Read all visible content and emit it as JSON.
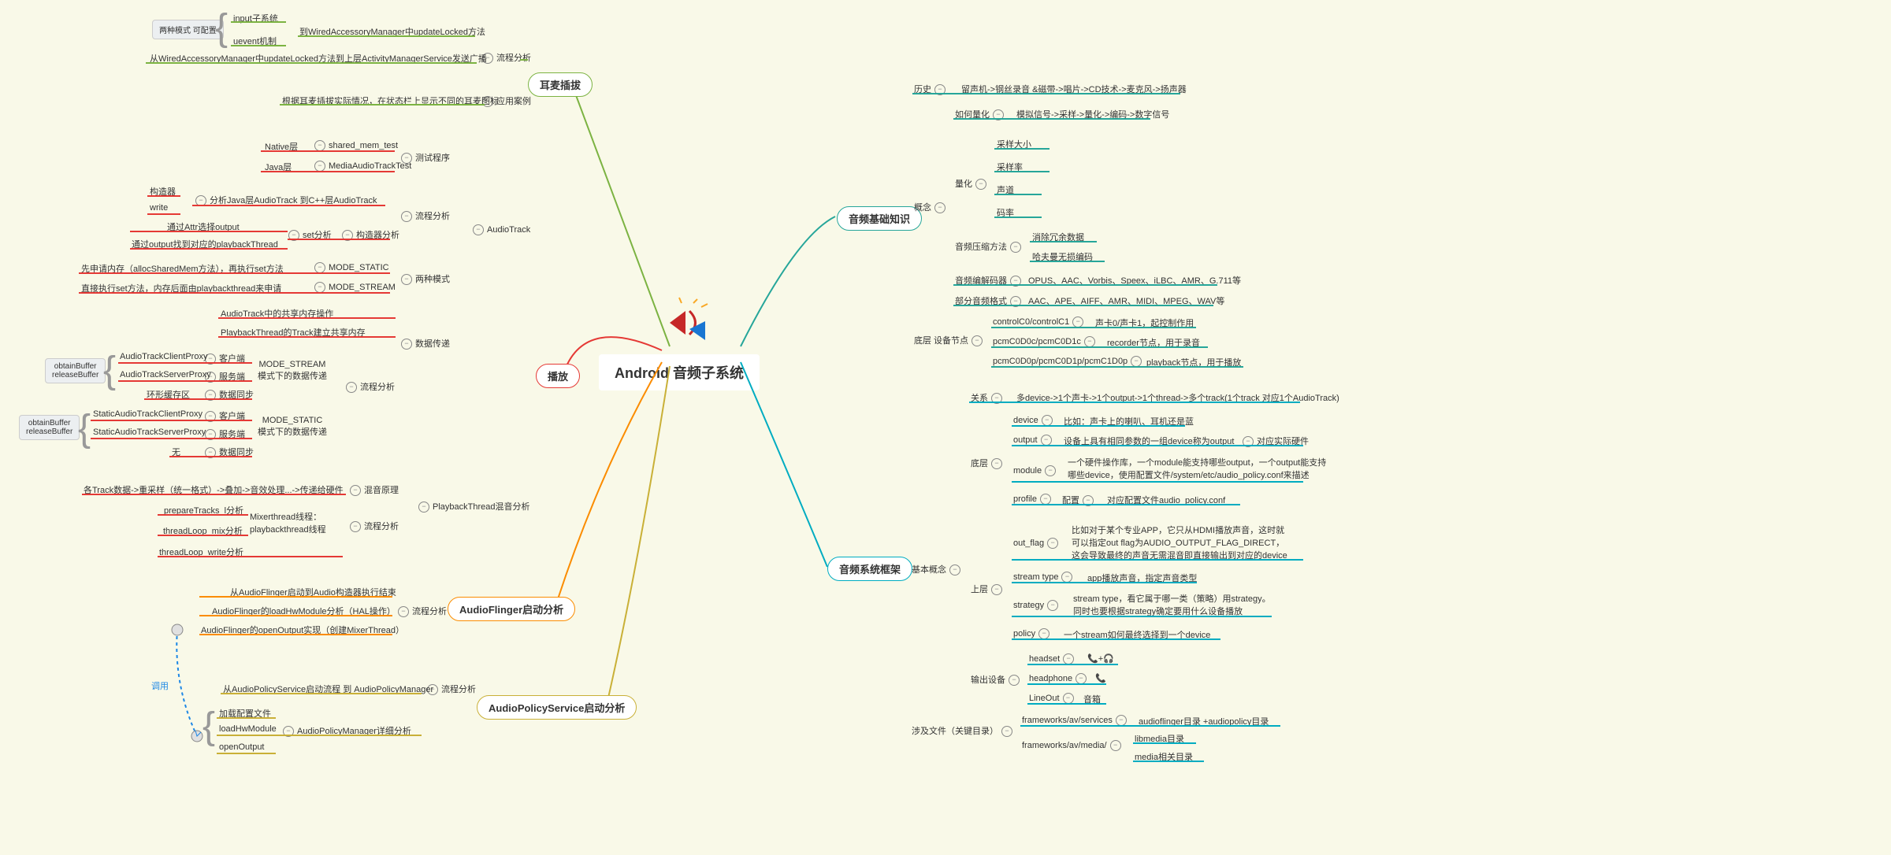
{
  "center": {
    "title": "Android 音频子系统"
  },
  "badges": {
    "mode_config": "两种模式 可配置",
    "obtain1": "obtainBuffer\nreleaseBuffer",
    "obtain2": "obtainBuffer\nreleaseBuffer",
    "invoke": "调用"
  },
  "branches": {
    "earjack": {
      "label": "耳麦插拔",
      "items": {
        "flow": "流程分析",
        "case": "应用案例",
        "input": "input子系统",
        "uevent": "uevent机制",
        "update": "到WiredAccessoryManager中updateLocked方法",
        "broadcast": "从WiredAccessoryManager中updateLocked方法到上层ActivityManagerService发送广播",
        "icon": "根据耳麦插拔实际情况，在状态栏上显示不同的耳麦图标"
      }
    },
    "playback": {
      "label": "播放",
      "nodes": {
        "audiotrack": "AudioTrack",
        "test": "测试程序",
        "native": "Native层",
        "shared_mem": "shared_mem_test",
        "java": "Java层",
        "mediatest": "MediaAudioTrackTest",
        "flow": "流程分析",
        "ctor": "构造器分析",
        "set": "set分析",
        "construct": "构造器",
        "write": "write",
        "java_cpp": "分析Java层AudioTrack 到C++层AudioTrack",
        "attr": "通过Attr选择output",
        "output_thread": "通过output找到对应的playbackThread",
        "twomode": "两种模式",
        "static": "MODE_STATIC",
        "stream": "MODE_STREAM",
        "static_desc": "先申请内存（allocSharedMem方法），再执行set方法",
        "stream_desc": "直接执行set方法，内存后面由playbackthread来申请",
        "data": "数据传递",
        "shared": "AudioTrack中的共享内存操作",
        "pbshared": "PlaybackThread的Track建立共享内存",
        "flow2": "流程分析",
        "stream_mode": "MODE_STREAM\n模式下的数据传递",
        "static_mode": "MODE_STATIC\n模式下的数据传递",
        "client": "客户端",
        "server": "服务端",
        "atcp": "AudioTrackClientProxy",
        "atsp": "AudioTrackServerProxy",
        "ring": "环形缓存区",
        "sync": "数据同步",
        "satcp": "StaticAudioTrackClientProxy",
        "satsp": "StaticAudioTrackServerProxy",
        "none": "无",
        "sync2": "数据同步",
        "pbmix": "PlaybackThread混音分析",
        "mixprinciple": "混音原理",
        "mixdesc": "各Track数据->重采样（统一格式）->叠加->音效处理...->传递给硬件",
        "flow3": "流程分析",
        "mixer": "Mixerthread线程：\nplaybackthread线程",
        "prepare": "prepareTracks_l分析",
        "tloop": "threadLoop_mix分析",
        "twrite": "threadLoop_write分析"
      }
    },
    "flinger": {
      "label": "AudioFlinger启动分析",
      "items": {
        "flow": "流程分析",
        "start": "从AudioFlinger启动到Audio构造器执行结束",
        "hal": "AudioFlinger的loadHwModule分析（HAL操作）",
        "open": "AudioFlinger的openOutput实现（创建MixerThread）"
      }
    },
    "policy": {
      "label": "AudioPolicyService启动分析",
      "items": {
        "flow": "流程分析",
        "start": "从AudioPolicyService启动流程 到 AudioPolicyManager",
        "mgr": "AudioPolicyManager详细分析",
        "load_config": "加载配置文件",
        "loadhw": "loadHwModule",
        "openout": "openOutput"
      }
    },
    "basics": {
      "label": "音频基础知识",
      "items": {
        "history": "历史",
        "history_v": "留声机->钢丝录音 &磁带->唱片->CD技术->麦克风->扬声器",
        "concept": "概念",
        "quant_how": "如何量化",
        "quant_how_v": "模拟信号->采样->量化->编码->数字信号",
        "quant": "量化",
        "sample_size": "采样大小",
        "sample_rate": "采样率",
        "channel": "声道",
        "bitrate": "码率",
        "compress": "音频压缩方法",
        "remove": "消除冗余数据",
        "huffman": "哈夫曼无损编码",
        "codec": "音频编解码器",
        "codec_v": "OPUS、AAC、Vorbis、Speex、iLBC、AMR、G.711等",
        "format": "部分音频格式",
        "format_v": "AAC、APE、AIFF、AMR、MIDI、MPEG、WAV等",
        "bottom": "底层 设备节点",
        "control": "controlC0/controlC1",
        "control_v": "声卡0/声卡1，起控制作用",
        "pcm_c": "pcmC0D0c/pcmC0D1c",
        "pcm_c_v": "recorder节点，用于录音",
        "pcm_p": "pcmC0D0p/pcmC0D1p/pcmC1D0p",
        "pcm_p_v": "playback节点，用于播放"
      }
    },
    "framework": {
      "label": "音频系统框架",
      "items": {
        "basic": "基本概念",
        "relation": "关系",
        "relation_v": "多device->1个声卡->1个output->1个thread->多个track(1个track 对应1个AudioTrack)",
        "bottom": "底层",
        "device": "device",
        "device_v": "比如：声卡上的喇叭、耳机还是蓝",
        "output": "output",
        "output_v": "设备上具有相同参数的一组device称为output",
        "output_v2": "对应实际硬件",
        "module": "module",
        "module_v": "一个硬件操作库，一个module能支持哪些output，一个output能支持\n哪些device，使用配置文件/system/etc/audio_policy.conf来描述",
        "profile": "profile",
        "profile_v1": "配置",
        "profile_v2": "对应配置文件audio_policy.conf",
        "upper": "上层",
        "outflag": "out_flag",
        "outflag_v": "比如对于某个专业APP，它只从HDMI播放声音，这时就\n可以指定out flag为AUDIO_OUTPUT_FLAG_DIRECT，\n这会导致最终的声音无需混音即直接输出到对应的device",
        "streamtype": "stream type",
        "streamtype_v": "app播放声音，指定声音类型",
        "strategy": "strategy",
        "strategy_v": "stream type，看它属于哪一类（策略）用strategy。\n同时也要根据strategy确定要用什么设备播放",
        "policy": "policy",
        "policy_v": "一个stream如何最终选择到一个device",
        "outdev": "输出设备",
        "headset": "headset",
        "headphone": "headphone",
        "lineout": "LineOut",
        "speaker": "音箱",
        "headset_icon": "📞+🎧",
        "headphone_icon": "📞",
        "files": "涉及文件（关键目录）",
        "services": "frameworks/av/services",
        "services_v": "audioflinger目录 +audiopolicy目录",
        "media": "frameworks/av/media/",
        "libmedia": "libmedia目录",
        "mediadir": "media相关目录"
      }
    }
  }
}
